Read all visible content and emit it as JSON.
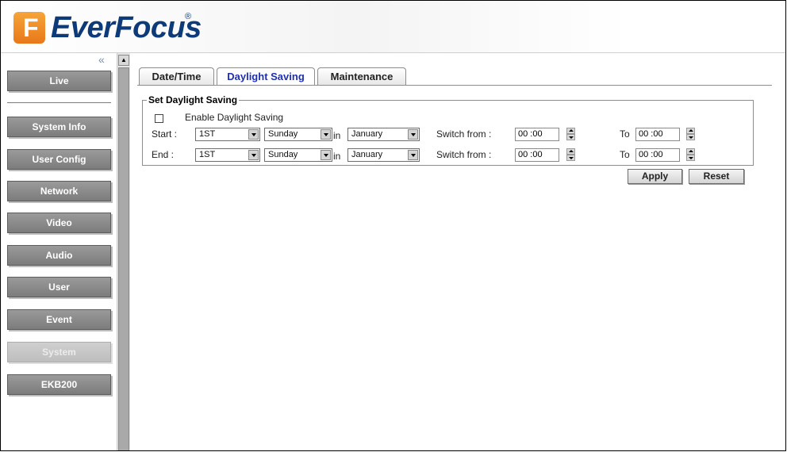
{
  "brand": {
    "name": "EverFocus",
    "registered_mark": "®",
    "logo_letter": "F"
  },
  "sidebar": {
    "collapse_glyph": "«",
    "items": [
      {
        "label": "Live",
        "active": false
      },
      {
        "label": "System Info",
        "active": false
      },
      {
        "label": "User Config",
        "active": false
      },
      {
        "label": "Network",
        "active": false
      },
      {
        "label": "Video",
        "active": false
      },
      {
        "label": "Audio",
        "active": false
      },
      {
        "label": "User",
        "active": false
      },
      {
        "label": "Event",
        "active": false
      },
      {
        "label": "System",
        "active": true
      },
      {
        "label": "EKB200",
        "active": false
      }
    ]
  },
  "tabs": [
    {
      "label": "Date/Time",
      "active": false
    },
    {
      "label": "Daylight Saving",
      "active": true
    },
    {
      "label": "Maintenance",
      "active": false
    }
  ],
  "section": {
    "title": "Set Daylight Saving",
    "enable_label": "Enable Daylight Saving",
    "enable_checked": false,
    "rows": [
      {
        "label": "Start :",
        "week": "1ST",
        "day": "Sunday",
        "in_label": "in",
        "month": "January",
        "switch_label": "Switch from :",
        "from_time": "00 :00",
        "to_label": "To",
        "to_time": "00 :00"
      },
      {
        "label": "End :",
        "week": "1ST",
        "day": "Sunday",
        "in_label": "in",
        "month": "January",
        "switch_label": "Switch from :",
        "from_time": "00 :00",
        "to_label": "To",
        "to_time": "00 :00"
      }
    ]
  },
  "buttons": {
    "apply": "Apply",
    "reset": "Reset"
  },
  "colors": {
    "active_tab_text": "#1d2fb7",
    "logo_blue": "#0d3a78",
    "logo_orange": "#e8781a",
    "nav_button": "#8a8a8a"
  }
}
